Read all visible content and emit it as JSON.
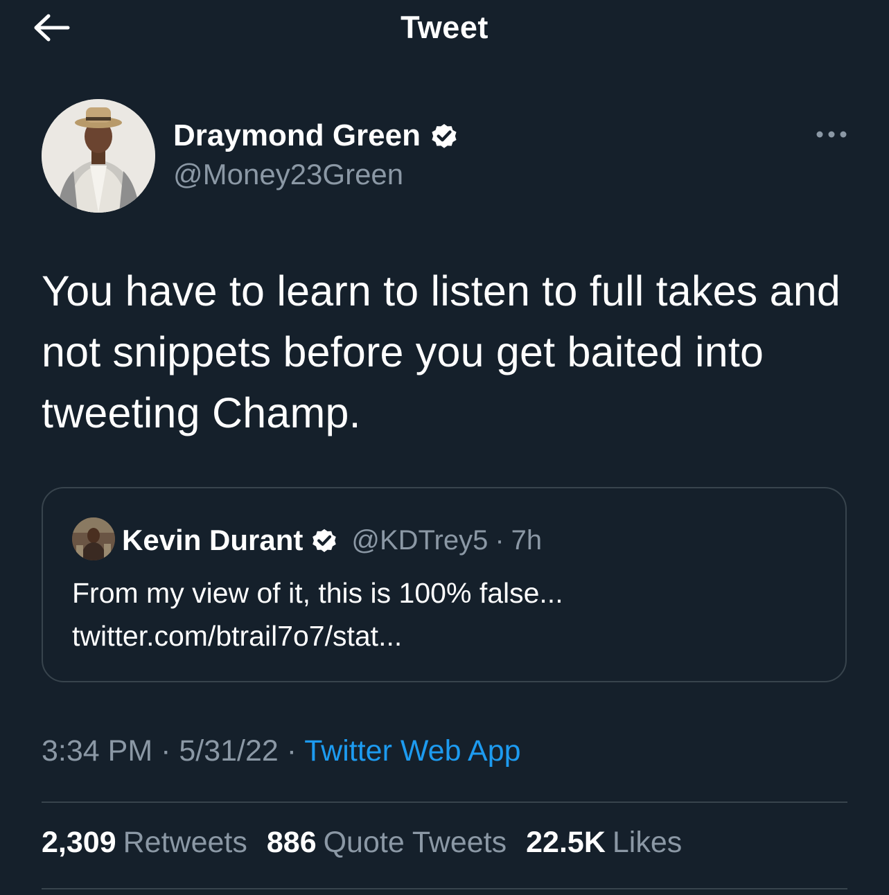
{
  "header": {
    "title": "Tweet",
    "back_icon": "arrow-left-icon"
  },
  "author": {
    "name": "Draymond Green",
    "handle": "@Money23Green",
    "verified": true,
    "verified_color": "#1d9bf0"
  },
  "tweet": {
    "text": "You have to learn to listen to full takes and not snippets before you get baited into tweeting Champ."
  },
  "quote": {
    "name": "Kevin Durant",
    "handle": "@KDTrey5",
    "separator": "·",
    "time": "7h",
    "verified": true,
    "line1": "From my view of it, this is 100% false...",
    "line2": "twitter.com/btrail7o7/stat..."
  },
  "meta": {
    "time": "3:34 PM",
    "sep1": " · ",
    "date": "5/31/22",
    "sep2": " · ",
    "source": "Twitter Web App"
  },
  "stats": {
    "retweets_count": "2,309",
    "retweets_label": "Retweets",
    "quotes_count": "886",
    "quotes_label": "Quote Tweets",
    "likes_count": "22.5K",
    "likes_label": "Likes"
  },
  "colors": {
    "background": "#15202b",
    "secondary_text": "#8b98a5",
    "accent": "#1d9bf0",
    "border": "#38444d"
  }
}
